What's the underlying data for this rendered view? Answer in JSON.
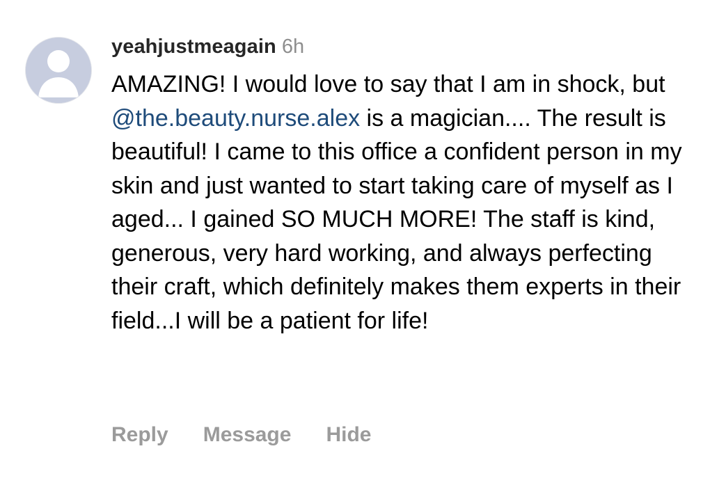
{
  "comment": {
    "username": "yeahjustmeagain",
    "timestamp": "6h",
    "text_before_mention": "AMAZING! I would love to say that I am in shock, but ",
    "mention": "@the.beauty.nurse.alex",
    "text_after_mention": " is a magician.... The result is beautiful! I came to this office a confident person in my skin and just wanted to start taking care of myself as I aged... I gained SO MUCH MORE! The staff is kind, generous, very hard working, and always perfecting their craft, which definitely makes them experts in their field...I will be a patient for life!",
    "avatar_icon": "default-user-avatar-icon"
  },
  "actions": {
    "reply_label": "Reply",
    "message_label": "Message",
    "hide_label": "Hide"
  },
  "colors": {
    "username": "#262626",
    "timestamp": "#8e8e8e",
    "mention": "#1e4b7a",
    "action_text": "#9b9b9b",
    "avatar_bg": "#c7cddf"
  }
}
